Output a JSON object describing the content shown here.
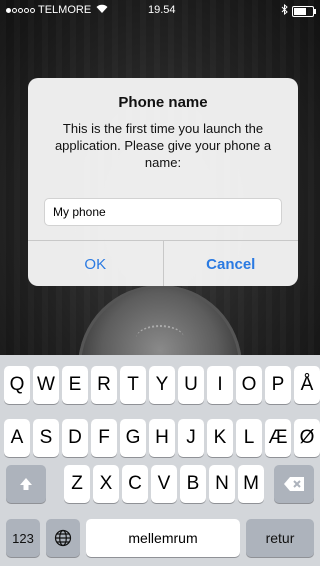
{
  "status_bar": {
    "carrier": "TELMORE",
    "time": "19.54",
    "signal_dots_filled": 1,
    "signal_dots_total": 5,
    "battery_level": 0.75
  },
  "dialog": {
    "title": "Phone name",
    "message": "This is the first time you launch the application. Please give your phone a name:",
    "input_value": "My phone",
    "ok_label": "OK",
    "cancel_label": "Cancel"
  },
  "keyboard": {
    "row1": [
      "Q",
      "W",
      "E",
      "R",
      "T",
      "Y",
      "U",
      "I",
      "O",
      "P",
      "Å"
    ],
    "row2": [
      "A",
      "S",
      "D",
      "F",
      "G",
      "H",
      "J",
      "K",
      "L",
      "Æ",
      "Ø"
    ],
    "row3": [
      "Z",
      "X",
      "C",
      "V",
      "B",
      "N",
      "M"
    ],
    "shift_icon": "shift-arrow-icon",
    "delete_icon": "backspace-icon",
    "numbers_label": "123",
    "globe_icon": "globe-icon",
    "space_label": "mellemrum",
    "return_label": "retur"
  },
  "colors": {
    "accent": "#2a7ae2",
    "keyboard_bg": "#d3d6da",
    "function_key": "#adb3bc"
  }
}
